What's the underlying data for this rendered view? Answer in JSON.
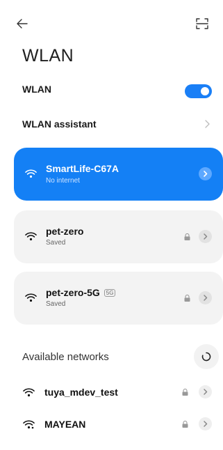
{
  "header": {
    "back_icon": "back-arrow-icon",
    "scan_icon": "scan-qr-icon",
    "title": "WLAN"
  },
  "settings": {
    "wlan_label": "WLAN",
    "wlan_enabled": true,
    "assistant_label": "WLAN assistant"
  },
  "saved_networks": [
    {
      "name": "SmartLife-C67A",
      "status": "No internet",
      "active": true
    },
    {
      "name": "pet-zero",
      "status": "Saved",
      "locked": true
    },
    {
      "name": "pet-zero-5G",
      "badge": "5G",
      "status": "Saved",
      "locked": true
    }
  ],
  "available": {
    "label": "Available networks",
    "refresh_icon": "refresh-icon",
    "networks": [
      {
        "name": "tuya_mdev_test",
        "locked": true
      },
      {
        "name": "MAYEAN",
        "locked": true
      }
    ]
  },
  "colors": {
    "accent": "#1480f5",
    "toggle_on": "#1a7ff6",
    "card_bg": "#f3f3f3"
  }
}
